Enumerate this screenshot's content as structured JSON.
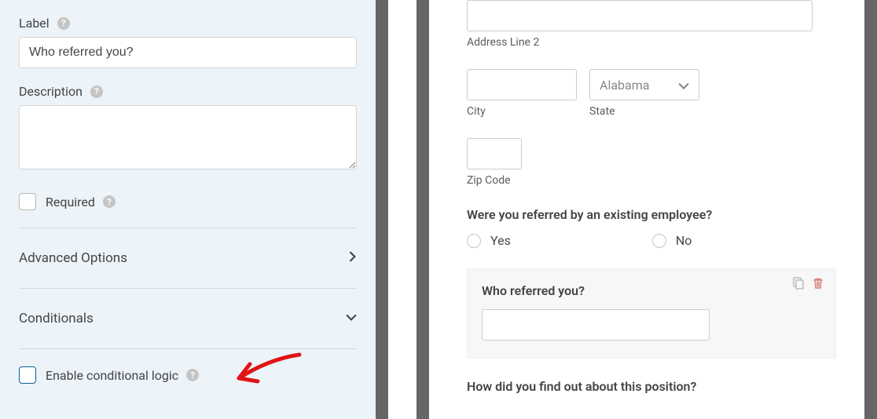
{
  "sidebar": {
    "label_field_label": "Label",
    "label_field_value": "Who referred you?",
    "description_field_label": "Description",
    "description_field_value": "",
    "required_label": "Required",
    "advanced_options_label": "Advanced Options",
    "conditionals_label": "Conditionals",
    "enable_conditional_label": "Enable conditional logic"
  },
  "preview": {
    "address_line_2_label": "Address Line 2",
    "city_label": "City",
    "state_label": "State",
    "state_value": "Alabama",
    "zip_label": "Zip Code",
    "referred_question": "Were you referred by an existing employee?",
    "radio_yes": "Yes",
    "radio_no": "No",
    "who_referred_label": "Who referred you?",
    "find_out_question": "How did you find out about this position?"
  }
}
